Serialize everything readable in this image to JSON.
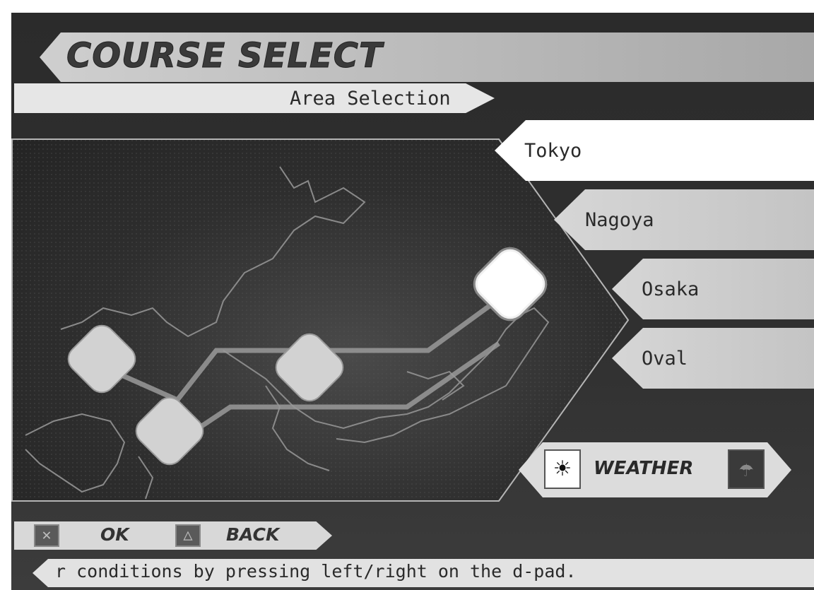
{
  "screen": {
    "title": "COURSE SELECT",
    "subtitle": "Area Selection"
  },
  "areas": [
    {
      "label": "Tokyo",
      "selected": true
    },
    {
      "label": "Nagoya",
      "selected": false
    },
    {
      "label": "Osaka",
      "selected": false
    },
    {
      "label": "Oval",
      "selected": false
    }
  ],
  "weather": {
    "label": "WEATHER",
    "options": [
      "sun-icon",
      "rain-icon"
    ],
    "selected": "sun-icon"
  },
  "controls": {
    "ok_label": "OK",
    "ok_icon": "cross-button-icon",
    "back_label": "BACK",
    "back_icon": "triangle-button-icon"
  },
  "hint": {
    "text": "r conditions by pressing left/right on the d-pad."
  },
  "colors": {
    "background": "#2b2b2b",
    "panel_light": "#d6d6d6",
    "selected": "#ffffff",
    "text": "#2a2a2a"
  }
}
